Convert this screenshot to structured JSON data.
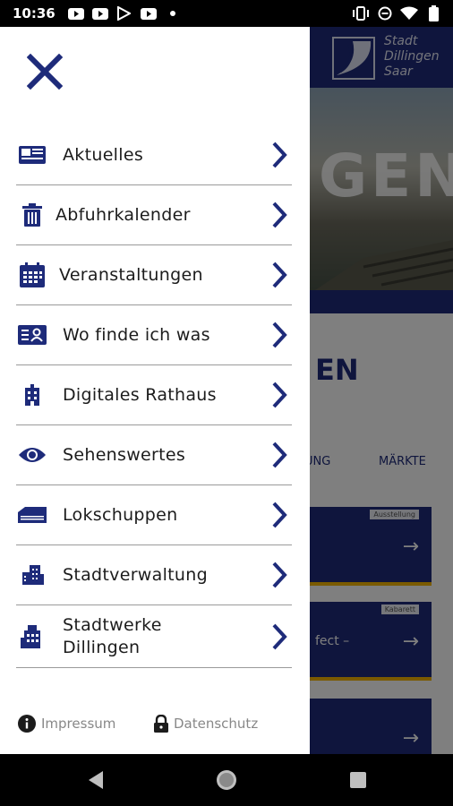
{
  "status_bar": {
    "time": "10:36",
    "left_icons": [
      "youtube-icon",
      "youtube-icon",
      "play-store-icon",
      "youtube-icon",
      "dot-icon"
    ],
    "right_icons": [
      "vibrate-icon",
      "do-not-disturb-icon",
      "wifi-icon",
      "battery-icon"
    ]
  },
  "background_app": {
    "logo_text": [
      "Stadt",
      "Dillingen",
      "Saar"
    ],
    "hero_text": "GEN",
    "heading": "EN",
    "tabs": [
      "UNG",
      "MÄRKTE"
    ],
    "cards": [
      {
        "badge": "Ausstellung",
        "text": ""
      },
      {
        "badge": "Kabarett",
        "text": "fect –"
      },
      {
        "badge": "",
        "text": ""
      }
    ]
  },
  "drawer": {
    "close_icon": "close-icon",
    "items": [
      {
        "label": "Aktuelles",
        "icon": "newspaper-icon"
      },
      {
        "label": "Abfuhrkalender",
        "icon": "trash-can-icon"
      },
      {
        "label": "Veranstaltungen",
        "icon": "calendar-icon"
      },
      {
        "label": "Wo finde ich was",
        "icon": "directory-icon"
      },
      {
        "label": "Digitales Rathaus",
        "icon": "city-hall-icon"
      },
      {
        "label": "Sehenswertes",
        "icon": "eye-icon"
      },
      {
        "label": "Lokschuppen",
        "icon": "warehouse-icon"
      },
      {
        "label": "Stadtverwaltung",
        "icon": "office-building-icon"
      },
      {
        "label": "Stadtwerke\nDillingen",
        "icon": "factory-icon"
      }
    ],
    "footer": {
      "impressum": "Impressum",
      "datenschutz": "Datenschutz"
    }
  },
  "colors": {
    "brand_blue": "#1e2b7a",
    "accent_yellow": "#f5b400"
  }
}
